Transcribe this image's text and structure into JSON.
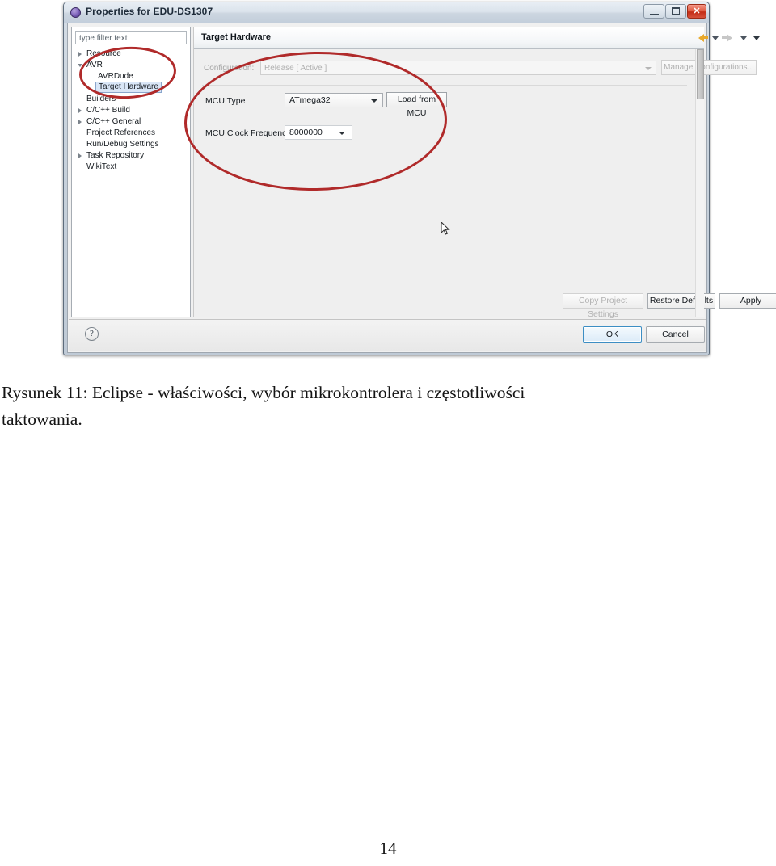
{
  "document": {
    "caption_prefix": "Rysunek 11:",
    "caption_line1": "Rysunek 11:  Eclipse - właściwości, wybór mikrokontrolera i częstotliwości",
    "caption_line2": "taktowania.",
    "page_number": "14"
  },
  "window": {
    "title": "Properties for EDU-DS1307",
    "icon": "eclipse-globe-icon",
    "controls": {
      "minimize": "minimize-button",
      "maximize": "maximize-button",
      "close": "✕"
    }
  },
  "sidebar": {
    "filter": {
      "placeholder": "type filter text",
      "value": ""
    },
    "items": [
      {
        "label": "Resource",
        "indent": 18,
        "expandable": true,
        "selected": false
      },
      {
        "label": "AVR",
        "indent": 18,
        "expandable": true,
        "expanded": true,
        "selected": false
      },
      {
        "label": "AVRDude",
        "indent": 32,
        "expandable": false,
        "selected": false
      },
      {
        "label": "Target Hardware",
        "indent": 32,
        "expandable": false,
        "selected": true
      },
      {
        "label": "Builders",
        "indent": 18,
        "expandable": false,
        "selected": false
      },
      {
        "label": "C/C++ Build",
        "indent": 18,
        "expandable": true,
        "selected": false
      },
      {
        "label": "C/C++ General",
        "indent": 18,
        "expandable": true,
        "selected": false
      },
      {
        "label": "Project References",
        "indent": 18,
        "expandable": false,
        "selected": false
      },
      {
        "label": "Run/Debug Settings",
        "indent": 18,
        "expandable": false,
        "selected": false
      },
      {
        "label": "Task Repository",
        "indent": 18,
        "expandable": true,
        "selected": false
      },
      {
        "label": "WikiText",
        "indent": 18,
        "expandable": false,
        "selected": false
      }
    ]
  },
  "content": {
    "title": "Target Hardware",
    "nav": {
      "back_icon": "back-arrow-icon",
      "back_menu_icon": "chevron-down-icon",
      "forward_icon": "forward-arrow-icon",
      "forward_menu_icon": "chevron-down-icon",
      "view_menu_icon": "view-menu-icon"
    },
    "configuration": {
      "label": "Configuration:",
      "value": "Release  [ Active ]",
      "manage_button": "Manage Configurations...",
      "disabled": true
    },
    "fields": [
      {
        "label": "MCU Type",
        "value": "ATmega32",
        "button": "Load from MCU"
      },
      {
        "label": "MCU Clock Frequency",
        "value": "8000000"
      }
    ],
    "page_buttons": [
      {
        "label": "Copy Project Settings",
        "enabled": false
      },
      {
        "label": "Restore Defaults",
        "enabled": true
      },
      {
        "label": "Apply",
        "enabled": true
      }
    ]
  },
  "footer": {
    "help_label": "?",
    "ok_label": "OK",
    "cancel_label": "Cancel"
  },
  "annotations": {
    "ellipse_color": "#b02a2a",
    "left_target": "Target Hardware tree node",
    "right_target": "MCU Type and MCU Clock Frequency fields"
  }
}
